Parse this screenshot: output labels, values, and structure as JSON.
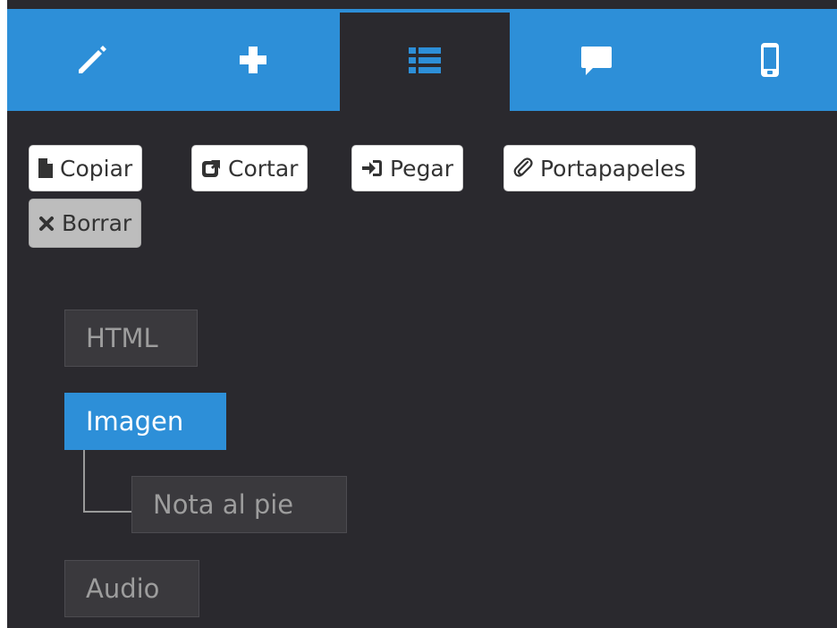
{
  "tabs": [
    {
      "icon": "pencil-icon",
      "active": false
    },
    {
      "icon": "plus-icon",
      "active": false
    },
    {
      "icon": "list-icon",
      "active": true
    },
    {
      "icon": "comment-icon",
      "active": false
    },
    {
      "icon": "mobile-icon",
      "active": false
    }
  ],
  "toolbar": {
    "copy_label": "Copiar",
    "cut_label": "Cortar",
    "paste_label": "Pegar",
    "clipboard_label": "Portapapeles",
    "delete_label": "Borrar"
  },
  "tree": {
    "nodes": [
      {
        "label": "HTML",
        "selected": false,
        "level": 0
      },
      {
        "label": "Imagen",
        "selected": true,
        "level": 0
      },
      {
        "label": "Nota al pie",
        "selected": false,
        "level": 1
      },
      {
        "label": "Audio",
        "selected": false,
        "level": 0
      }
    ]
  },
  "colors": {
    "accent": "#2d8fd8",
    "panel_bg": "#2a292e",
    "node_bg": "#3a393d",
    "node_text": "#9d9d9d"
  }
}
